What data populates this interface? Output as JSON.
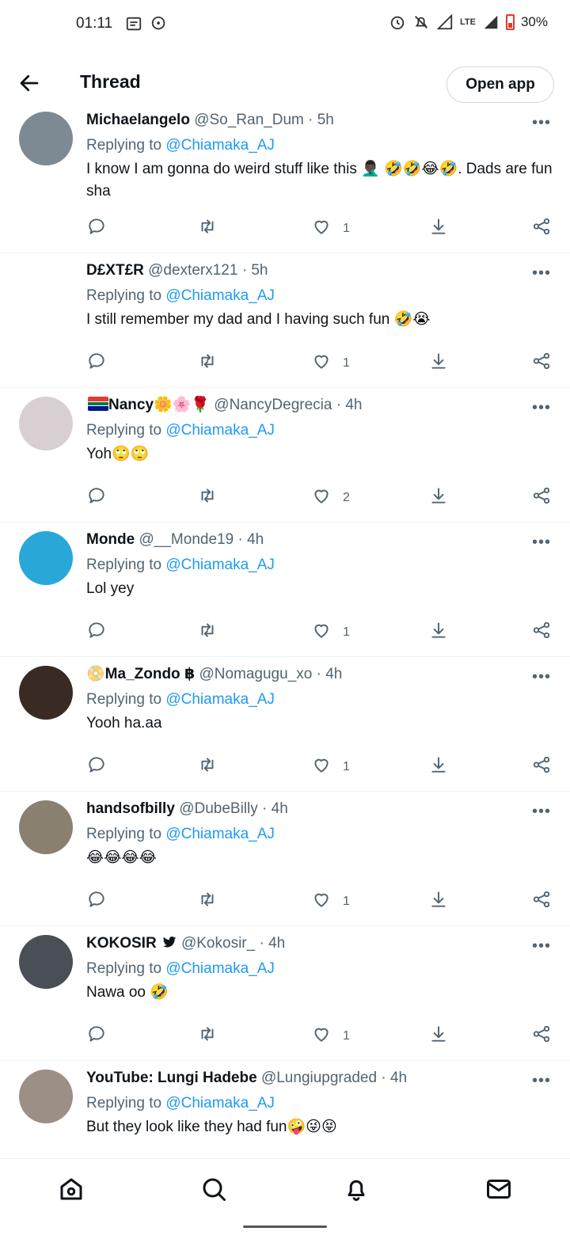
{
  "status_bar": {
    "time": "01:11",
    "network": "LTE",
    "battery": "30%"
  },
  "header": {
    "title": "Thread",
    "open_app_label": "Open app"
  },
  "tweets": [
    {
      "name": "Michaelangelo",
      "handle": "@So_Ran_Dum",
      "time": "5h",
      "replying_prefix": "Replying to",
      "replying_to": "@Chiamaka_AJ",
      "text": "I know I am gonna do weird stuff like this 🤦🏿‍♂️ 🤣🤣😂🤣. Dads are fun sha",
      "likes": "1",
      "avatar_color": "#7d8a93"
    },
    {
      "name": "D£XT£R",
      "handle": "@dexterx121",
      "time": "5h",
      "replying_prefix": "Replying to",
      "replying_to": "@Chiamaka_AJ",
      "text": "I still remember my dad and I having such fun 🤣😭",
      "likes": "1",
      "avatar_color": "#ffffff"
    },
    {
      "name": "Nancy🌼🌸🌹",
      "handle": "@NancyDegrecia",
      "time": "4h",
      "replying_prefix": "Replying to",
      "replying_to": "@Chiamaka_AJ",
      "text": "Yoh🙄🙄",
      "likes": "2",
      "avatar_color": "#d8cfd3",
      "flag": true
    },
    {
      "name": "Monde",
      "handle": "@__Monde19",
      "time": "4h",
      "replying_prefix": "Replying to",
      "replying_to": "@Chiamaka_AJ",
      "text": "Lol yey",
      "likes": "1",
      "avatar_color": "#2aa7d9"
    },
    {
      "name": "Ma_Zondo ฿",
      "handle": "@Nomagugu_xo",
      "time": "4h",
      "replying_prefix": "Replying to",
      "replying_to": "@Chiamaka_AJ",
      "text": "Yooh ha.aa",
      "likes": "1",
      "avatar_color": "#3a2a24",
      "prefix_icon": "📀"
    },
    {
      "name": "handsofbilly",
      "handle": "@DubeBilly",
      "time": "4h",
      "replying_prefix": "Replying to",
      "replying_to": "@Chiamaka_AJ",
      "text": "😂😂😂😂",
      "likes": "1",
      "avatar_color": "#8a8070"
    },
    {
      "name": "KOKOSIR",
      "handle": "@Kokosir_",
      "time": "4h",
      "replying_prefix": "Replying to",
      "replying_to": "@Chiamaka_AJ",
      "text": "Nawa oo 🤣",
      "likes": "1",
      "avatar_color": "#4a4f55",
      "bird": true
    },
    {
      "name": "YouTube: Lungi Hadebe",
      "handle": "@Lungiupgraded",
      "time": "4h",
      "replying_prefix": "Replying to",
      "replying_to": "@Chiamaka_AJ",
      "text": "But they look like they had fun🤪😜😝",
      "likes": "",
      "avatar_color": "#9c8f86"
    }
  ],
  "colors": {
    "accent": "#1d9bf0",
    "muted": "#536471",
    "divider": "#eff3f4"
  },
  "bottom_nav": [
    "home-icon",
    "search-icon",
    "bell-icon",
    "mail-icon"
  ]
}
